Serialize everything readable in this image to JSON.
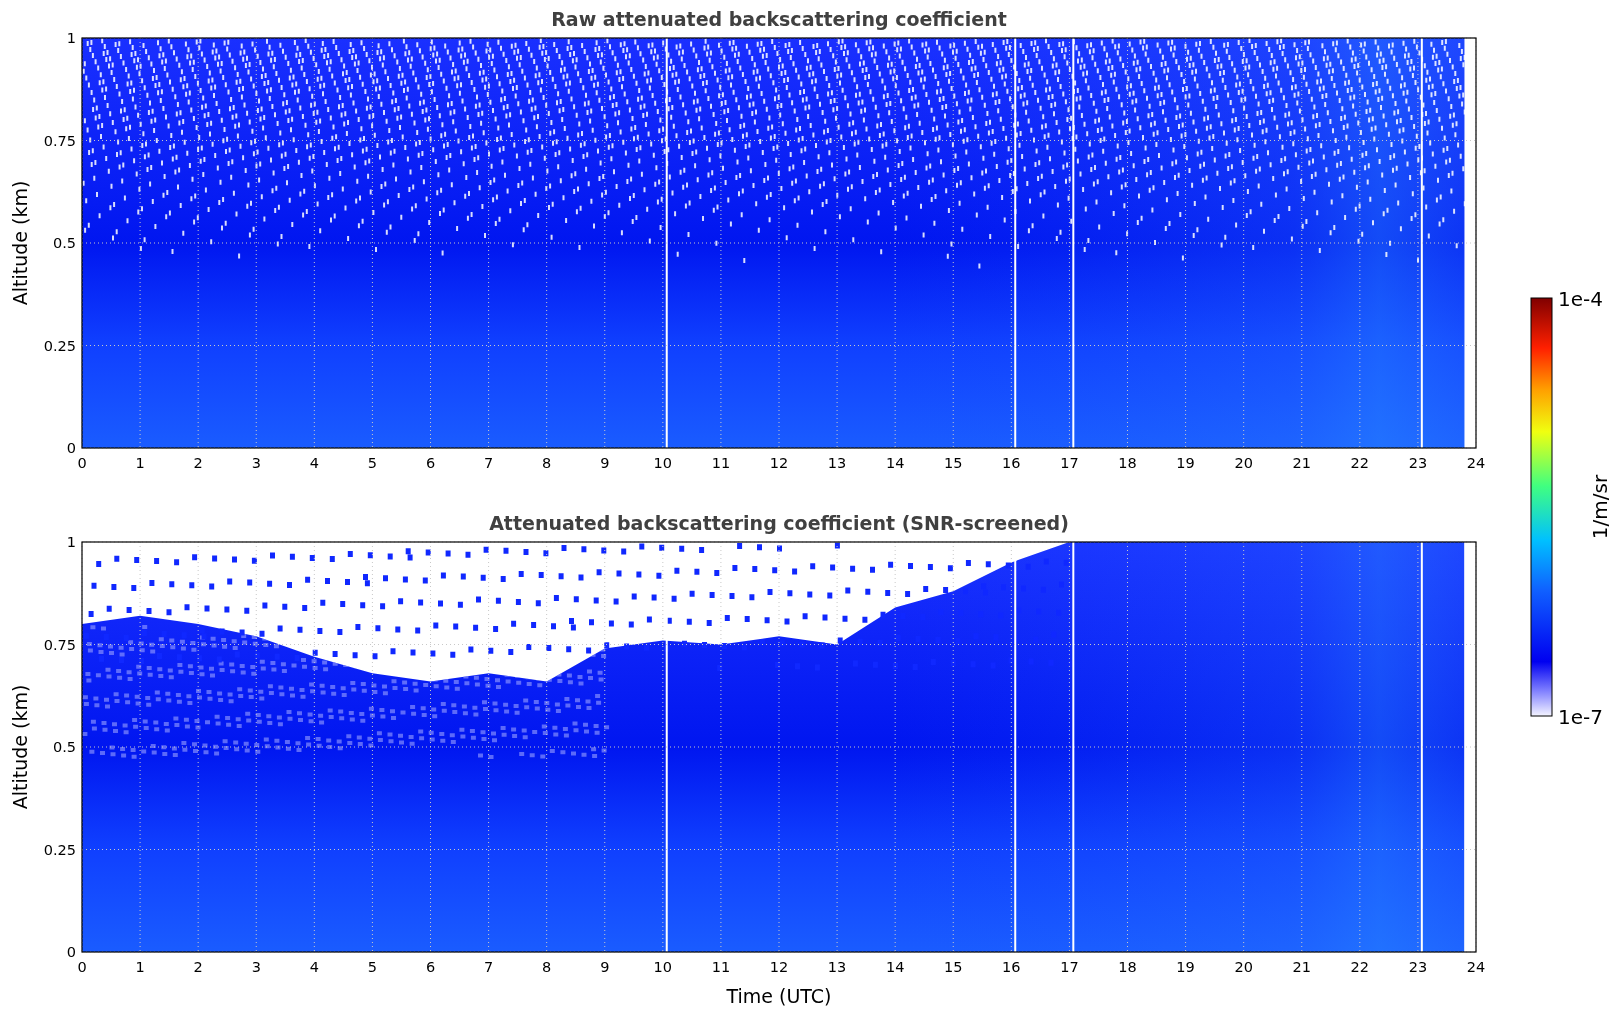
{
  "panels": [
    {
      "kind": "raw",
      "title": "Raw attenuated backscattering coefficient",
      "ylabel": "Altitude (km)",
      "yticks": [
        "1",
        "0.75",
        "0.5",
        "0.25",
        "0"
      ],
      "xticks": [
        "0",
        "1",
        "2",
        "3",
        "4",
        "5",
        "6",
        "7",
        "8",
        "9",
        "10",
        "11",
        "12",
        "13",
        "14",
        "15",
        "16",
        "17",
        "18",
        "19",
        "20",
        "21",
        "22",
        "23",
        "24"
      ]
    },
    {
      "kind": "screened",
      "title": "Attenuated backscattering coefficient (SNR-screened)",
      "ylabel": "Altitude (km)",
      "xlabel": "Time (UTC)",
      "yticks": [
        "1",
        "0.75",
        "0.5",
        "0.25",
        "0"
      ],
      "xticks": [
        "0",
        "1",
        "2",
        "3",
        "4",
        "5",
        "6",
        "7",
        "8",
        "9",
        "10",
        "11",
        "12",
        "13",
        "14",
        "15",
        "16",
        "17",
        "18",
        "19",
        "20",
        "21",
        "22",
        "23",
        "24"
      ]
    }
  ],
  "colorbar": {
    "max_label": "1e-4",
    "min_label": "1e-7",
    "label": "1/m/sr"
  }
}
